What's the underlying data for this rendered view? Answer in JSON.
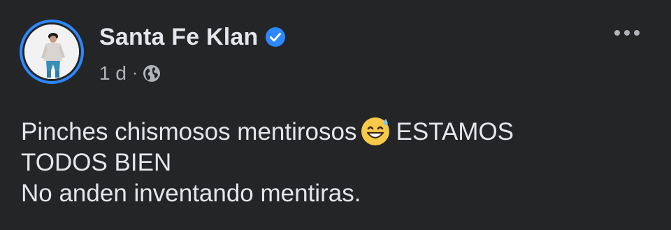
{
  "post": {
    "author": "Santa Fe Klan",
    "verified": true,
    "time": "1 d",
    "separator": "·",
    "privacy_icon": "globe-icon",
    "more_icon": "more-options-icon",
    "text_line1_before_emoji": "Pinches chismosos mentirosos",
    "emoji": "grinning-face-with-sweat-emoji",
    "text_line1_after_emoji": "ESTAMOS",
    "text_line2": "TODOS BIEN",
    "text_line3": "No anden inventando mentiras."
  },
  "colors": {
    "background": "#242526",
    "primary_text": "#e4e6eb",
    "secondary_text": "#b0b3b8",
    "accent": "#2d88ff"
  }
}
